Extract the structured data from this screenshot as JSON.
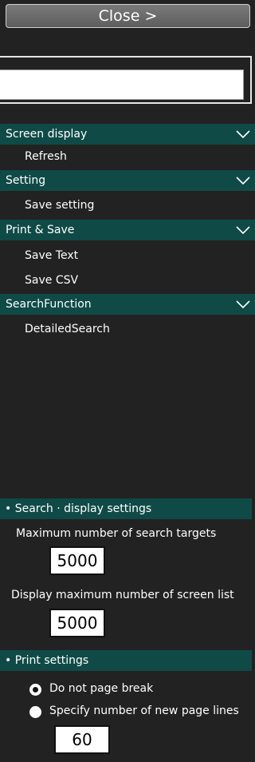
{
  "close_button": {
    "label": "Close >"
  },
  "search": {
    "value": "",
    "placeholder": ""
  },
  "menu": [
    {
      "header": "Screen display",
      "items": [
        "Refresh"
      ]
    },
    {
      "header": "Setting",
      "items": [
        "Save setting"
      ]
    },
    {
      "header": "Print & Save",
      "items": [
        "Save Text",
        "Save CSV"
      ]
    },
    {
      "header": "SearchFunction",
      "items": [
        "DetailedSearch"
      ]
    }
  ],
  "search_display_settings": {
    "header": "• Search · display settings",
    "max_search_targets_label": "Maximum number of search targets",
    "max_search_targets_value": "5000",
    "max_screen_list_label": "Display maximum number of screen list",
    "max_screen_list_value": "5000"
  },
  "print_settings": {
    "header": "• Print settings",
    "options": [
      {
        "label": "Do not page break",
        "selected": true
      },
      {
        "label": "Specify number of new page lines",
        "selected": false
      }
    ],
    "page_lines_value": "60"
  },
  "colors": {
    "background": "#222222",
    "header_bg": "#0f4a47",
    "accent_text": "#ffffff"
  }
}
